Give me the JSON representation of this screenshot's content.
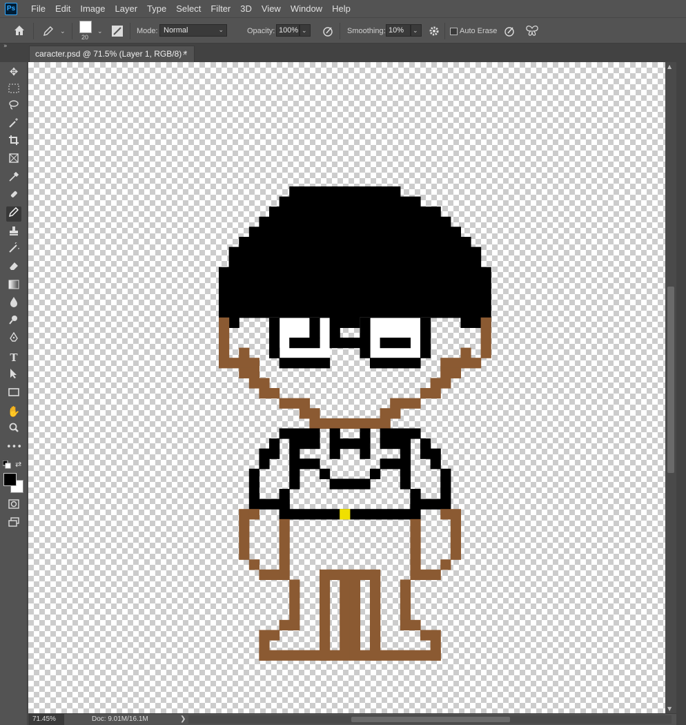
{
  "app": {
    "logo_text": "Ps",
    "menu": [
      "File",
      "Edit",
      "Image",
      "Layer",
      "Type",
      "Select",
      "Filter",
      "3D",
      "View",
      "Window",
      "Help"
    ]
  },
  "options": {
    "brush_size": "20",
    "mode_label": "Mode:",
    "mode_value": "Normal",
    "opacity_label": "Opacity:",
    "opacity_value": "100%",
    "smoothing_label": "Smoothing:",
    "smoothing_value": "10%",
    "auto_erase_label": "Auto Erase",
    "auto_erase_checked": false
  },
  "document": {
    "tab_title": "caracter.psd @ 71.5% (Layer 1, RGB/8) *",
    "close_glyph": "×"
  },
  "toolbar": {
    "active_tool": "pencil-tool",
    "tools": [
      "move-tool",
      "rectangular-marquee-tool",
      "lasso-tool",
      "magic-wand-tool",
      "crop-tool",
      "frame-tool",
      "eyedropper-tool",
      "healing-brush-tool",
      "pencil-tool",
      "clone-stamp-tool",
      "history-brush-tool",
      "eraser-tool",
      "gradient-tool",
      "blur-tool",
      "dodge-tool",
      "pen-tool",
      "type-tool",
      "path-selection-tool",
      "rectangle-tool",
      "hand-tool",
      "zoom-tool",
      "more-tools",
      "default-colors",
      "quick-mask",
      "screen-mode"
    ],
    "foreground_color": "#000000",
    "background_color": "#ffffff"
  },
  "status": {
    "zoom": "71.45%",
    "doc_info": "Doc: 9.01M/16.1M",
    "arrow": "❯"
  },
  "colors": {
    "hair": "#000000",
    "outline": "#000000",
    "skin_outline": "#8b5a32",
    "belt_buckle": "#f0e000"
  }
}
